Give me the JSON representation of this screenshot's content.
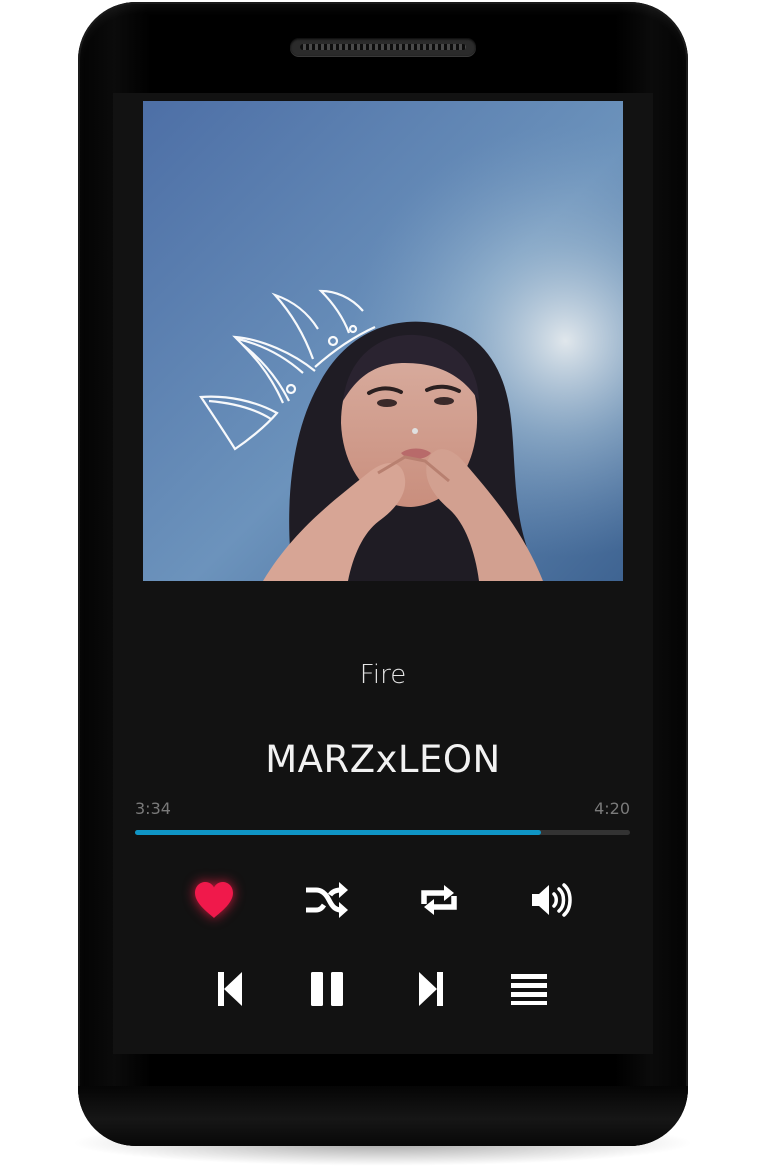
{
  "player": {
    "song_title": "Fire",
    "artist": "MARZxLEON",
    "time_elapsed": "3:34",
    "time_total": "4:20",
    "progress": 0.821,
    "liked": true
  },
  "controls": {
    "secondary": [
      "heart-icon",
      "shuffle-icon",
      "repeat-icon",
      "volume-icon"
    ],
    "primary": [
      "previous-icon",
      "pause-icon",
      "next-icon",
      "playlist-icon"
    ]
  },
  "colors": {
    "screen_background": "#121212",
    "progress_accent": "#0f95c5",
    "like_active": "#f0194b",
    "icon": "#ffffff"
  }
}
